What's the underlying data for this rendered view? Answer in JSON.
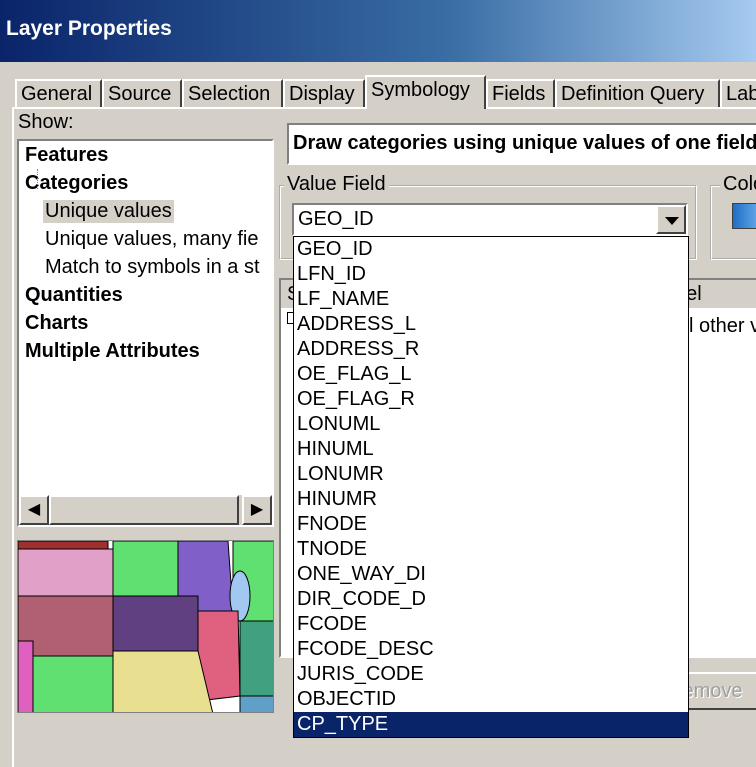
{
  "window": {
    "title": "Layer Properties"
  },
  "tabs": [
    "General",
    "Source",
    "Selection",
    "Display",
    "Symbology",
    "Fields",
    "Definition Query",
    "Lab"
  ],
  "active_tab": "Symbology",
  "show": {
    "label": "Show:",
    "items": [
      {
        "label": "Features",
        "level": 0
      },
      {
        "label": "Categories",
        "level": 0
      },
      {
        "label": "Unique values",
        "level": 1,
        "selected": true
      },
      {
        "label": "Unique values, many fie",
        "level": 1
      },
      {
        "label": "Match to symbols in a st",
        "level": 1
      },
      {
        "label": "Quantities",
        "level": 0
      },
      {
        "label": "Charts",
        "level": 0
      },
      {
        "label": "Multiple Attributes",
        "level": 0
      }
    ]
  },
  "description": "Draw categories using unique values of one field.",
  "value_field": {
    "label": "Value Field",
    "selected": "GEO_ID",
    "options": [
      "GEO_ID",
      "LFN_ID",
      "LF_NAME",
      "ADDRESS_L",
      "ADDRESS_R",
      "OE_FLAG_L",
      "OE_FLAG_R",
      "LONUML",
      "HINUML",
      "LONUMR",
      "HINUMR",
      "FNODE",
      "TNODE",
      "ONE_WAY_DI",
      "DIR_CODE_D",
      "FCODE",
      "FCODE_DESC",
      "JURIS_CODE",
      "OBJECTID",
      "CP_TYPE"
    ],
    "highlighted": "CP_TYPE"
  },
  "color_ramp": {
    "label": "Colo"
  },
  "table": {
    "col_symbol": "S",
    "col_label": "bel",
    "row_all_other": "l other v"
  },
  "buttons": {
    "remove": "Remove"
  },
  "colors": {
    "title_start": "#0a246a",
    "title_end": "#a6caf0",
    "selection": "#0a246a"
  }
}
